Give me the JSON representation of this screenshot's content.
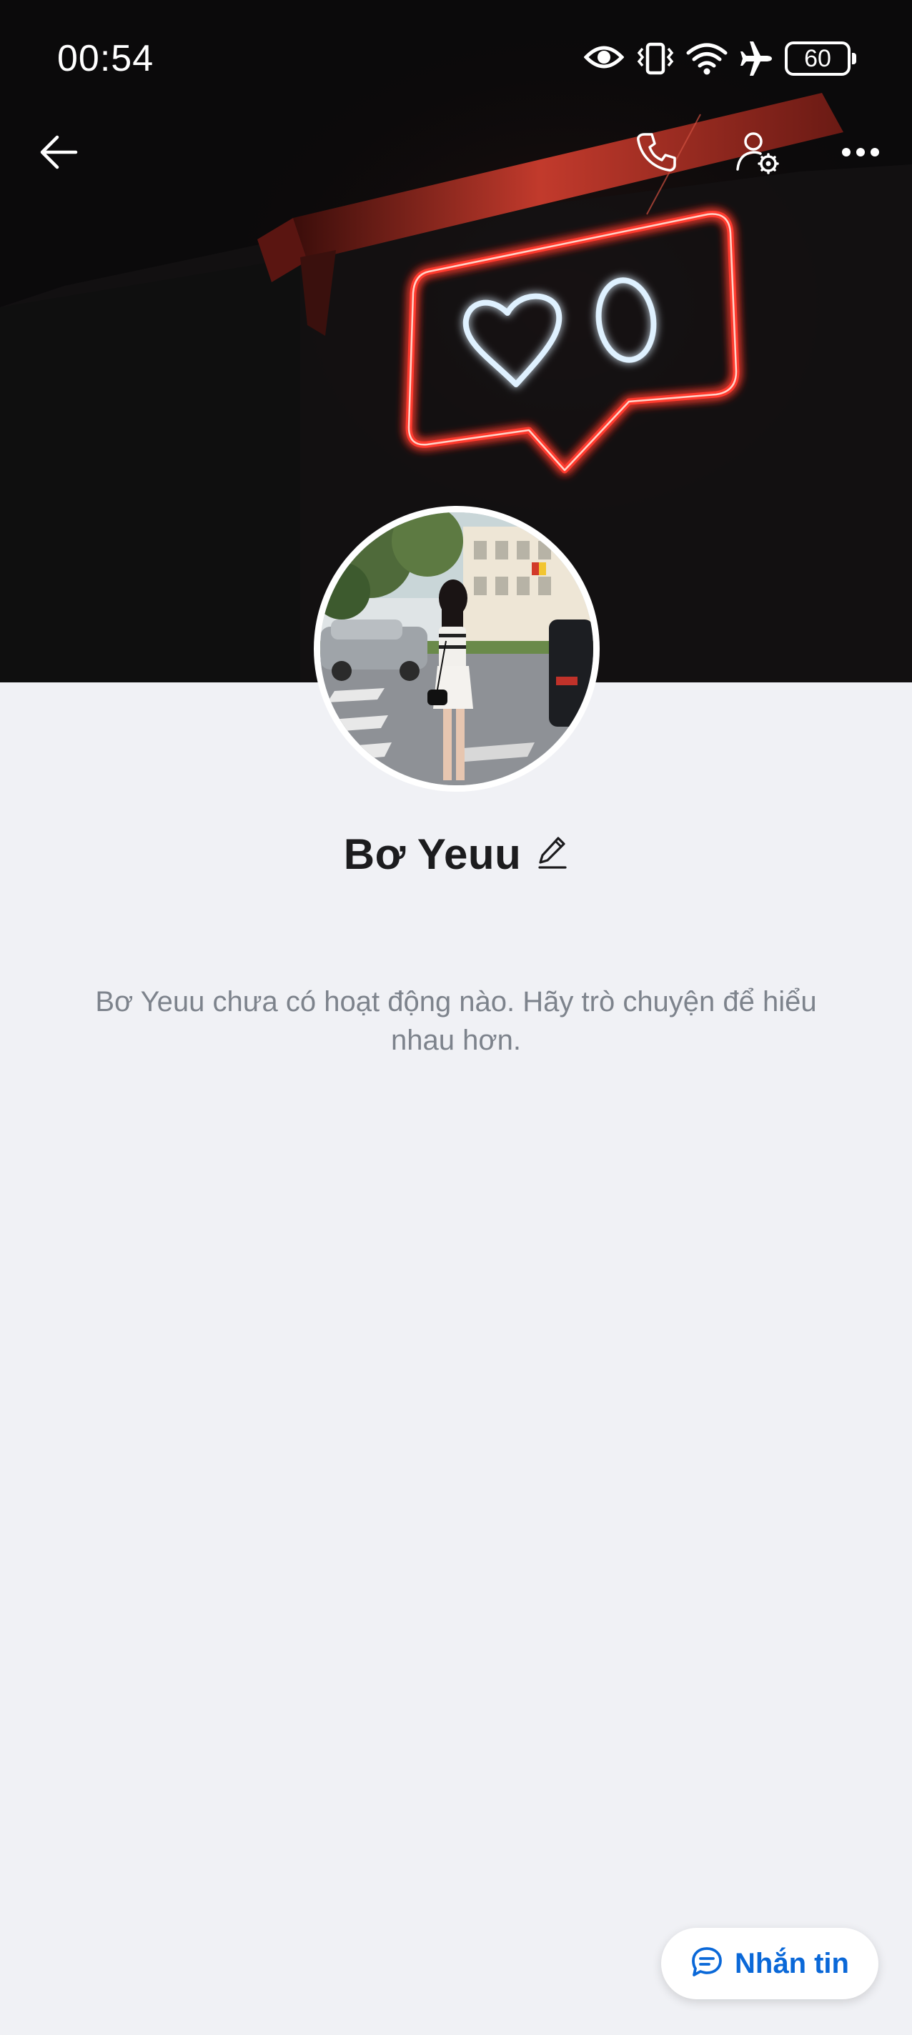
{
  "status_bar": {
    "time": "00:54",
    "battery_level": "60",
    "icons": [
      "eye-icon",
      "vibrate-icon",
      "wifi-icon",
      "airplane-icon",
      "battery-icon"
    ]
  },
  "header": {
    "back_icon": "arrow-left-icon",
    "call_icon": "phone-icon",
    "settings_icon": "user-settings-icon",
    "more_icon": "more-horizontal-icon"
  },
  "profile": {
    "name": "Bơ Yeuu",
    "edit_icon": "pencil-icon"
  },
  "feed": {
    "empty_message": "Bơ Yeuu chưa có hoạt động nào. Hãy trò chuyện để hiểu nhau hơn."
  },
  "actions": {
    "message_label": "Nhắn tin",
    "message_icon": "chat-bubble-icon"
  },
  "colors": {
    "accent": "#0a68d8",
    "background": "#f0f1f5",
    "neon_red": "#ff3b2f",
    "neon_white": "#e6f4ff"
  }
}
